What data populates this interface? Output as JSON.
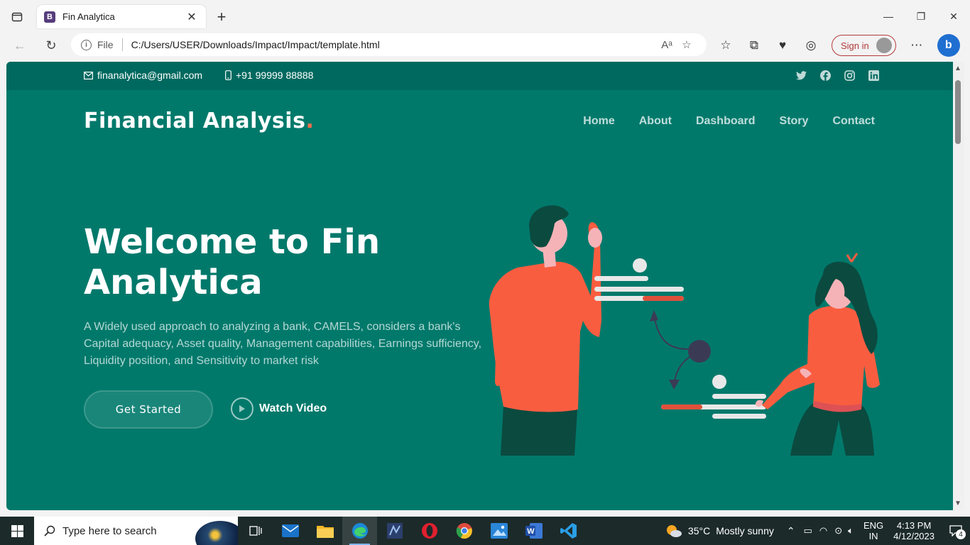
{
  "browser": {
    "tab_title": "Fin Analytica",
    "tab_favicon": "B",
    "address_label": "File",
    "url": "C:/Users/USER/Downloads/Impact/Impact/template.html",
    "signin_label": "Sign in"
  },
  "page": {
    "email": "finanalytica@gmail.com",
    "phone": "+91 99999 88888",
    "socials": [
      "twitter-icon",
      "facebook-icon",
      "instagram-icon",
      "linkedin-icon"
    ],
    "logo_text": "Financial Analysis",
    "logo_dot": ".",
    "nav": [
      "Home",
      "About",
      "Dashboard",
      "Story",
      "Contact"
    ],
    "hero_title": "Welcome to Fin Analytica",
    "hero_description": "A Widely used approach to analyzing a bank, CAMELS, considers a bank's Capital adequacy, Asset quality, Management capabilities, Earnings sufficiency, Liquidity position, and Sensitivity to market risk",
    "cta_primary": "Get Started",
    "cta_secondary": "Watch Video",
    "colors": {
      "background": "#00796b",
      "topbar": "#00695f",
      "accent": "#f96f4a"
    }
  },
  "taskbar": {
    "search_placeholder": "Type here to search",
    "weather_temp": "35°C",
    "weather_desc": "Mostly sunny",
    "lang_top": "ENG",
    "lang_bottom": "IN",
    "time": "4:13 PM",
    "date": "4/12/2023",
    "notification_count": "4"
  }
}
